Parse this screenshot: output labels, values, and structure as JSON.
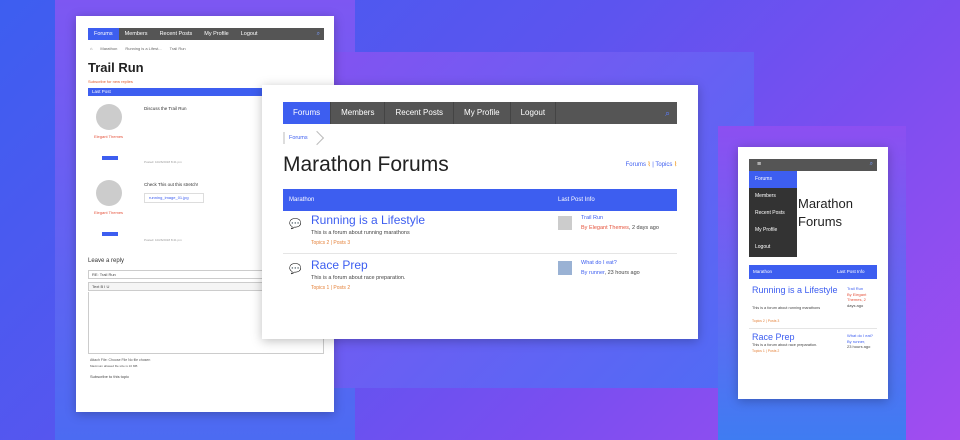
{
  "nav": {
    "items": [
      "Forums",
      "Members",
      "Recent Posts",
      "My Profile",
      "Logout"
    ],
    "search_icon": "search-icon"
  },
  "breadcrumb": {
    "label": "Forums"
  },
  "main": {
    "title": "Marathon Forums",
    "feeds": {
      "forums": "Forums",
      "topics": "Topics",
      "sep": "|"
    },
    "table": {
      "col_forum": "Marathon",
      "col_last": "Last Post Info",
      "rows": [
        {
          "name": "Running is a Lifestyle",
          "desc": "This is a forum about running marathons",
          "counts": "Topics 2 | Posts 3",
          "last_title": "Trail Run",
          "last_by_prefix": "By",
          "last_author": "Elegant Themes",
          "last_time": ", 2 days ago"
        },
        {
          "name": "Race Prep",
          "desc": "This is a forum about race preparation.",
          "counts": "Topics 1 | Posts 2",
          "last_title": "What do I eat?",
          "last_by_prefix": "By",
          "last_author": "runner",
          "last_time": ", 23 hours ago"
        }
      ]
    }
  },
  "left": {
    "nav": [
      "Forums",
      "Members",
      "Recent Posts",
      "My Profile",
      "Logout"
    ],
    "breadcrumb": [
      "Marathon",
      "Running is a Lifest...",
      "Trail Run"
    ],
    "title": "Trail Run",
    "subscribe_link": "Subscribe for new replies",
    "head": "Last Post",
    "post1": {
      "author": "Elegant Themes",
      "text": "Discuss the Trail Run",
      "posted": "Posted: 10/26/2018 8:41 pm"
    },
    "post2": {
      "author": "Elegant Themes",
      "text": "Check This out this stretch!",
      "attachment": "running_image_01.jpg",
      "posted": "Posted: 10/26/2018 8:41 pm"
    },
    "leave_reply": "Leave a reply",
    "reply_input": "RE: Trail Run",
    "toolbar": "Text  B  I  U",
    "attach": "Attach File:   Choose File   No file chosen",
    "max": "Maximum allowed file size is 10 MB",
    "subscribe": "Subscribe to this topic"
  },
  "mobile": {
    "menu": [
      "Forums",
      "Members",
      "Recent Posts",
      "My Profile",
      "Logout"
    ],
    "title_line1": "Marathon",
    "title_line2": "Forums",
    "col_forum": "Marathon",
    "col_last": "Last Post Info",
    "rows": [
      {
        "name": "Running is a Lifestyle",
        "desc": "This is a forum about running marathons",
        "counts": "Topics 2 | Posts 3",
        "lp1": "Trail Run",
        "lp2": "By Elegant Themes, 2",
        "lp3": "days ago"
      },
      {
        "name": "Race Prep",
        "desc": "This is a forum about race preparation.",
        "counts": "Topics 1 | Posts 2",
        "lp1": "What do I eat?",
        "lp2": "By runner,",
        "lp3": "23 hours ago"
      }
    ]
  },
  "colors": {
    "accent": "#3d5ef0",
    "author": "#e5533c",
    "counts": "#e5833c",
    "nav_bg": "#555555"
  }
}
